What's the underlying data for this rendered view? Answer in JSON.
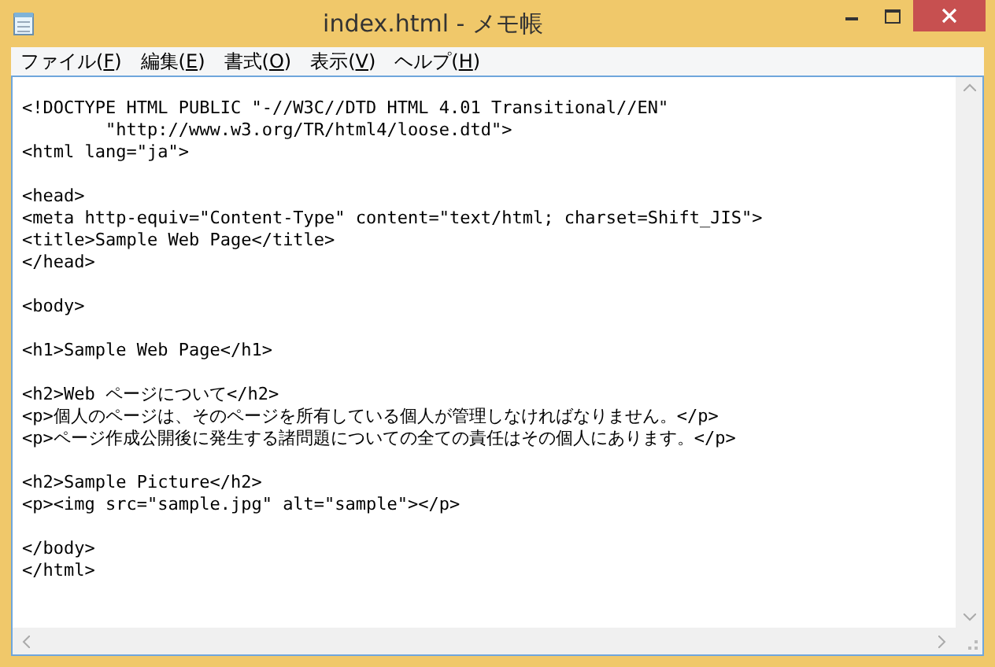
{
  "window": {
    "title": "index.html - メモ帳"
  },
  "menu": [
    {
      "label": "ファイル(F)"
    },
    {
      "label": "編集(E)"
    },
    {
      "label": "書式(O)"
    },
    {
      "label": "表示(V)"
    },
    {
      "label": "ヘルプ(H)"
    }
  ],
  "editor": {
    "blocks": [
      [
        "<!DOCTYPE HTML PUBLIC \"-//W3C//DTD HTML 4.01 Transitional//EN\"",
        "        \"http://www.w3.org/TR/html4/loose.dtd\">",
        "<html lang=\"ja\">"
      ],
      [
        "<head>",
        "<meta http-equiv=\"Content-Type\" content=\"text/html; charset=Shift_JIS\">",
        "<title>Sample Web Page</title>",
        "</head>"
      ],
      [
        "<body>"
      ],
      [
        "<h1>Sample Web Page</h1>"
      ],
      [
        "<h2>Web ページについて</h2>",
        "<p>個人のページは、そのページを所有している個人が管理しなければなりません。</p>",
        "<p>ページ作成公開後に発生する諸問題についての全ての責任はその個人にあります。</p>"
      ],
      [
        "<h2>Sample Picture</h2>",
        "<p><img src=\"sample.jpg\" alt=\"sample\"></p>"
      ],
      [
        "</body>",
        "</html>"
      ]
    ]
  }
}
